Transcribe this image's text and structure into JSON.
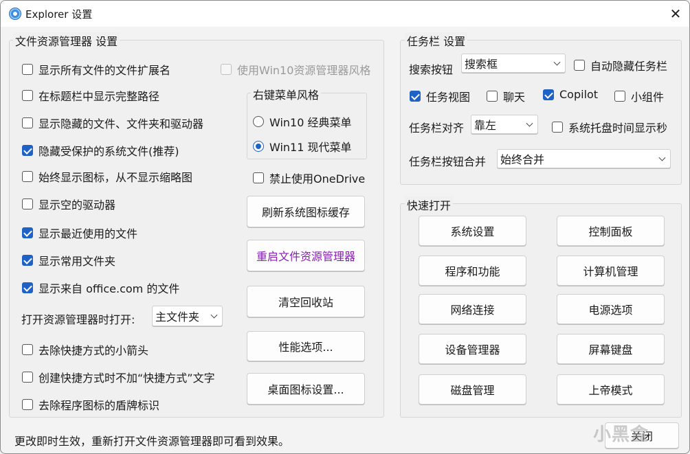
{
  "window": {
    "title": "Explorer 设置",
    "close_glyph": "✕"
  },
  "explorer": {
    "title": "文件资源管理器 设置",
    "options": [
      {
        "label": "显示所有文件的文件扩展名",
        "checked": false
      },
      {
        "label": "在标题栏中显示完整路径",
        "checked": false
      },
      {
        "label": "显示隐藏的文件、文件夹和驱动器",
        "checked": false
      },
      {
        "label": "隐藏受保护的系统文件(推荐)",
        "checked": true
      },
      {
        "label": "始终显示图标，从不显示缩略图",
        "checked": false
      },
      {
        "label": "显示空的驱动器",
        "checked": false
      },
      {
        "label": "显示最近使用的文件",
        "checked": true
      },
      {
        "label": "显示常用文件夹",
        "checked": true
      },
      {
        "label": "显示来自 office.com 的文件",
        "checked": true
      }
    ],
    "open_label": "打开资源管理器时打开:",
    "open_value": "主文件夹",
    "extra_options": [
      {
        "label": "去除快捷方式的小箭头",
        "checked": false
      },
      {
        "label": "创建快捷方式时不加“快捷方式”文字",
        "checked": false
      },
      {
        "label": "去除程序图标的盾牌标识",
        "checked": false
      }
    ],
    "win10_style": {
      "label": "使用Win10资源管理器风格",
      "checked": false,
      "disabled": true
    },
    "context_menu": {
      "title": "右键菜单风格",
      "options": [
        {
          "label": "Win10 经典菜单",
          "selected": false
        },
        {
          "label": "Win11 现代菜单",
          "selected": true
        }
      ]
    },
    "disable_onedrive": {
      "label": "禁止使用OneDrive",
      "checked": false
    },
    "buttons": {
      "refresh_icons": "刷新系统图标缓存",
      "restart_explorer": "重启文件资源管理器",
      "empty_bin": "清空回收站",
      "performance": "性能选项...",
      "desktop_icons": "桌面图标设置..."
    }
  },
  "taskbar": {
    "title": "任务栏 设置",
    "search_label": "搜索按钮",
    "search_value": "搜索框",
    "auto_hide": {
      "label": "自动隐藏任务栏",
      "checked": false
    },
    "task_view": {
      "label": "任务视图",
      "checked": true
    },
    "chat": {
      "label": "聊天",
      "checked": false
    },
    "copilot": {
      "label": "Copilot",
      "checked": true
    },
    "widgets": {
      "label": "小组件",
      "checked": false
    },
    "align_label": "任务栏对齐",
    "align_value": "靠左",
    "tray_seconds": {
      "label": "系统托盘时间显示秒",
      "checked": false
    },
    "combine_label": "任务栏按钮合并",
    "combine_value": "始终合并"
  },
  "quick_open": {
    "title": "快速打开",
    "buttons": [
      "系统设置",
      "控制面板",
      "程序和功能",
      "计算机管理",
      "网络连接",
      "电源选项",
      "设备管理器",
      "屏幕键盘",
      "磁盘管理",
      "上帝模式"
    ]
  },
  "footer": {
    "status": "更改即时生效，重新打开文件资源管理器即可看到效果。",
    "close_label": "关闭",
    "watermark": "小黑盒"
  },
  "colors": {
    "accent": "#1e62c6",
    "restart_button_text": "#8a1db5"
  }
}
